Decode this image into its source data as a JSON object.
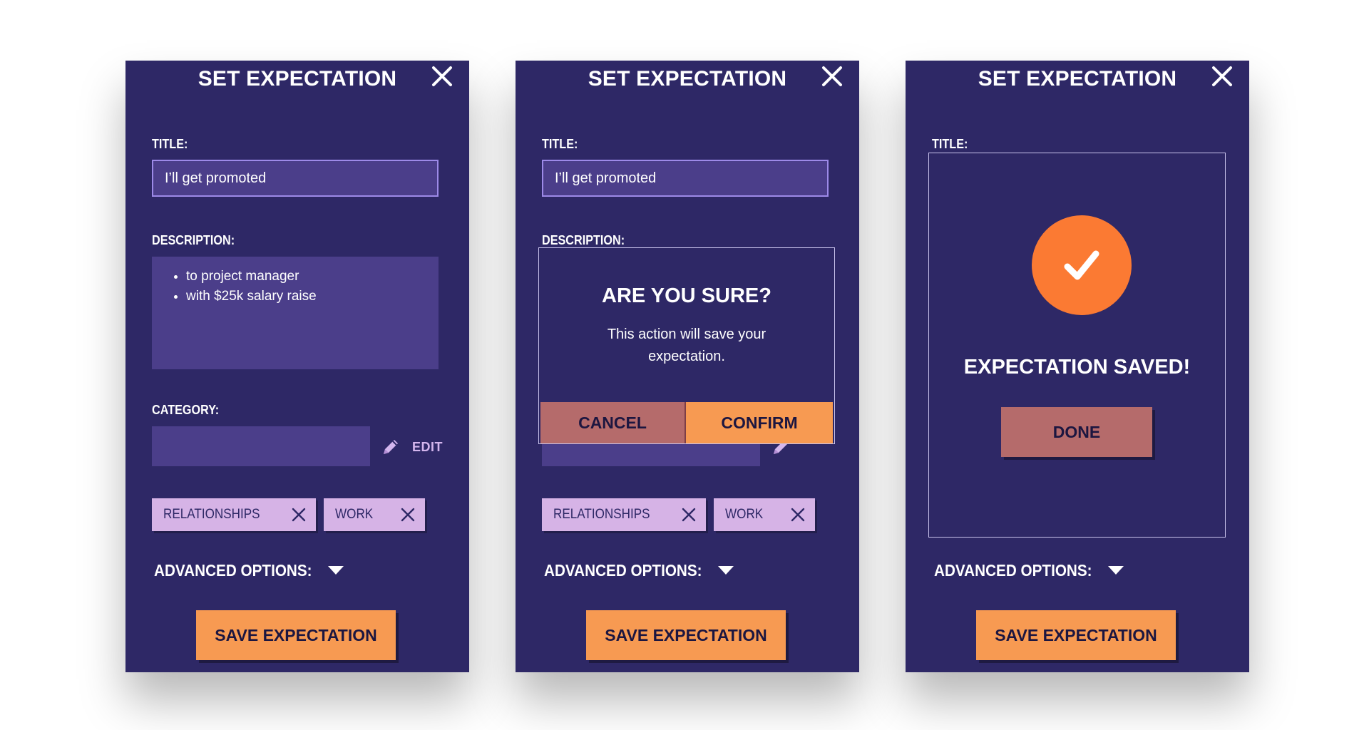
{
  "colors": {
    "panel_bg": "#2e2866",
    "input_bg": "#4b3e8a",
    "accent_orange": "#f79a52",
    "chip_bg": "#d6b3e6",
    "cancel_bg": "#b56b6b",
    "success_orange": "#fb7a33"
  },
  "panels": [
    {
      "title": "SET EXPECTATION",
      "title_label": "TITLE:",
      "title_value": "I’ll get promoted",
      "description_label": "DESCRIPTION:",
      "description_items": [
        "to project manager",
        "with $25k salary raise"
      ],
      "category_label": "CATEGORY:",
      "edit_label": "EDIT",
      "chips": [
        "RELATIONSHIPS",
        "WORK"
      ],
      "advanced_label": "ADVANCED OPTIONS:",
      "save_label": "SAVE EXPECTATION"
    },
    {
      "title": "SET EXPECTATION",
      "title_label": "TITLE:",
      "title_value": "I’ll get promoted",
      "description_label": "DESCRIPTION:",
      "chips": [
        "RELATIONSHIPS",
        "WORK"
      ],
      "advanced_label": "ADVANCED OPTIONS:",
      "save_label": "SAVE EXPECTATION",
      "dialog": {
        "title": "ARE YOU SURE?",
        "message": "This action will save your expectation.",
        "cancel_label": "CANCEL",
        "confirm_label": "CONFIRM"
      }
    },
    {
      "title": "SET EXPECTATION",
      "title_label": "TITLE:",
      "advanced_label": "ADVANCED OPTIONS:",
      "save_label": "SAVE EXPECTATION",
      "success": {
        "icon": "checkmark-icon",
        "message": "EXPECTATION SAVED!",
        "done_label": "DONE"
      }
    }
  ]
}
